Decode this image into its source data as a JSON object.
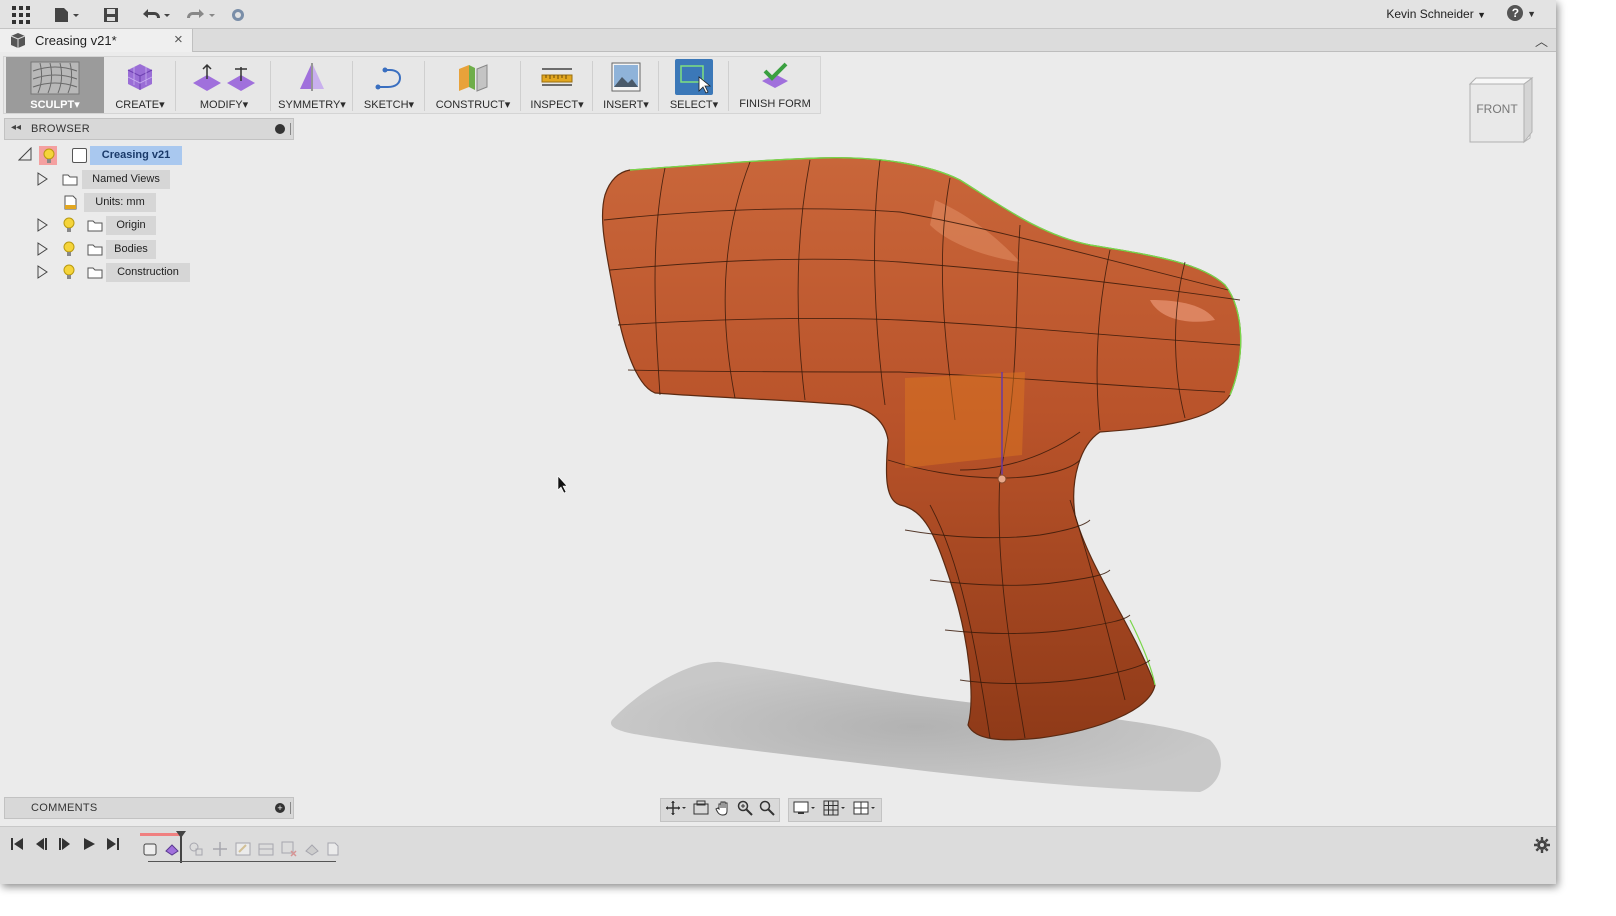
{
  "app": {
    "document_tab": "Creasing v21*",
    "user_name": "Kevin Schneider",
    "help_label": "?"
  },
  "toolbar": {
    "items": [
      {
        "label": "SCULPT",
        "dropdown": "▾",
        "active": true
      },
      {
        "label": "CREATE",
        "dropdown": "▾"
      },
      {
        "label": "MODIFY",
        "dropdown": "▾"
      },
      {
        "label": "SYMMETRY",
        "dropdown": "▾"
      },
      {
        "label": "SKETCH",
        "dropdown": "▾"
      },
      {
        "label": "CONSTRUCT",
        "dropdown": "▾"
      },
      {
        "label": "INSPECT",
        "dropdown": "▾"
      },
      {
        "label": "INSERT",
        "dropdown": "▾"
      },
      {
        "label": "SELECT",
        "dropdown": "▾"
      },
      {
        "label": "FINISH FORM",
        "dropdown": ""
      }
    ]
  },
  "browser": {
    "title": "BROWSER",
    "root": "Creasing v21",
    "items": [
      {
        "label": "Named Views"
      },
      {
        "label": "Units: mm"
      },
      {
        "label": "Origin"
      },
      {
        "label": "Bodies"
      },
      {
        "label": "Construction"
      }
    ]
  },
  "comments": {
    "title": "COMMENTS"
  },
  "viewcube": {
    "face_label": "FRONT"
  },
  "colors": {
    "body": "#b9532a",
    "body_dark": "#8f3a18",
    "window_bg": "#ebebeb",
    "select_active": "#3b78b8",
    "tree_highlight": "#a9c8ef"
  }
}
